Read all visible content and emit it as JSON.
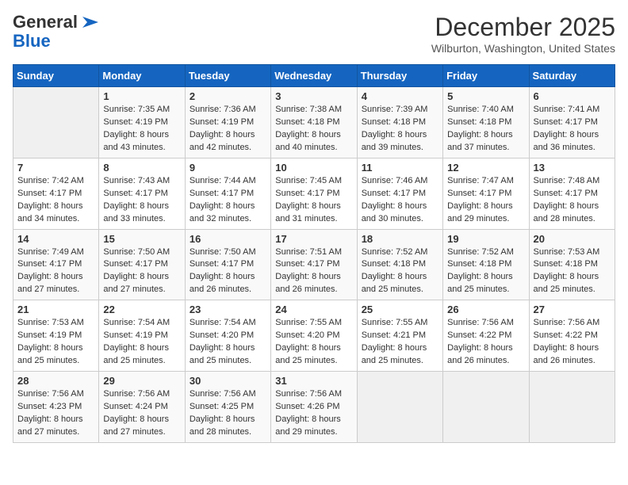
{
  "header": {
    "logo_line1": "General",
    "logo_line2": "Blue",
    "month": "December 2025",
    "location": "Wilburton, Washington, United States"
  },
  "days_of_week": [
    "Sunday",
    "Monday",
    "Tuesday",
    "Wednesday",
    "Thursday",
    "Friday",
    "Saturday"
  ],
  "weeks": [
    [
      {
        "day": "",
        "info": ""
      },
      {
        "day": "1",
        "info": "Sunrise: 7:35 AM\nSunset: 4:19 PM\nDaylight: 8 hours\nand 43 minutes."
      },
      {
        "day": "2",
        "info": "Sunrise: 7:36 AM\nSunset: 4:19 PM\nDaylight: 8 hours\nand 42 minutes."
      },
      {
        "day": "3",
        "info": "Sunrise: 7:38 AM\nSunset: 4:18 PM\nDaylight: 8 hours\nand 40 minutes."
      },
      {
        "day": "4",
        "info": "Sunrise: 7:39 AM\nSunset: 4:18 PM\nDaylight: 8 hours\nand 39 minutes."
      },
      {
        "day": "5",
        "info": "Sunrise: 7:40 AM\nSunset: 4:18 PM\nDaylight: 8 hours\nand 37 minutes."
      },
      {
        "day": "6",
        "info": "Sunrise: 7:41 AM\nSunset: 4:17 PM\nDaylight: 8 hours\nand 36 minutes."
      }
    ],
    [
      {
        "day": "7",
        "info": "Sunrise: 7:42 AM\nSunset: 4:17 PM\nDaylight: 8 hours\nand 34 minutes."
      },
      {
        "day": "8",
        "info": "Sunrise: 7:43 AM\nSunset: 4:17 PM\nDaylight: 8 hours\nand 33 minutes."
      },
      {
        "day": "9",
        "info": "Sunrise: 7:44 AM\nSunset: 4:17 PM\nDaylight: 8 hours\nand 32 minutes."
      },
      {
        "day": "10",
        "info": "Sunrise: 7:45 AM\nSunset: 4:17 PM\nDaylight: 8 hours\nand 31 minutes."
      },
      {
        "day": "11",
        "info": "Sunrise: 7:46 AM\nSunset: 4:17 PM\nDaylight: 8 hours\nand 30 minutes."
      },
      {
        "day": "12",
        "info": "Sunrise: 7:47 AM\nSunset: 4:17 PM\nDaylight: 8 hours\nand 29 minutes."
      },
      {
        "day": "13",
        "info": "Sunrise: 7:48 AM\nSunset: 4:17 PM\nDaylight: 8 hours\nand 28 minutes."
      }
    ],
    [
      {
        "day": "14",
        "info": "Sunrise: 7:49 AM\nSunset: 4:17 PM\nDaylight: 8 hours\nand 27 minutes."
      },
      {
        "day": "15",
        "info": "Sunrise: 7:50 AM\nSunset: 4:17 PM\nDaylight: 8 hours\nand 27 minutes."
      },
      {
        "day": "16",
        "info": "Sunrise: 7:50 AM\nSunset: 4:17 PM\nDaylight: 8 hours\nand 26 minutes."
      },
      {
        "day": "17",
        "info": "Sunrise: 7:51 AM\nSunset: 4:17 PM\nDaylight: 8 hours\nand 26 minutes."
      },
      {
        "day": "18",
        "info": "Sunrise: 7:52 AM\nSunset: 4:18 PM\nDaylight: 8 hours\nand 25 minutes."
      },
      {
        "day": "19",
        "info": "Sunrise: 7:52 AM\nSunset: 4:18 PM\nDaylight: 8 hours\nand 25 minutes."
      },
      {
        "day": "20",
        "info": "Sunrise: 7:53 AM\nSunset: 4:18 PM\nDaylight: 8 hours\nand 25 minutes."
      }
    ],
    [
      {
        "day": "21",
        "info": "Sunrise: 7:53 AM\nSunset: 4:19 PM\nDaylight: 8 hours\nand 25 minutes."
      },
      {
        "day": "22",
        "info": "Sunrise: 7:54 AM\nSunset: 4:19 PM\nDaylight: 8 hours\nand 25 minutes."
      },
      {
        "day": "23",
        "info": "Sunrise: 7:54 AM\nSunset: 4:20 PM\nDaylight: 8 hours\nand 25 minutes."
      },
      {
        "day": "24",
        "info": "Sunrise: 7:55 AM\nSunset: 4:20 PM\nDaylight: 8 hours\nand 25 minutes."
      },
      {
        "day": "25",
        "info": "Sunrise: 7:55 AM\nSunset: 4:21 PM\nDaylight: 8 hours\nand 25 minutes."
      },
      {
        "day": "26",
        "info": "Sunrise: 7:56 AM\nSunset: 4:22 PM\nDaylight: 8 hours\nand 26 minutes."
      },
      {
        "day": "27",
        "info": "Sunrise: 7:56 AM\nSunset: 4:22 PM\nDaylight: 8 hours\nand 26 minutes."
      }
    ],
    [
      {
        "day": "28",
        "info": "Sunrise: 7:56 AM\nSunset: 4:23 PM\nDaylight: 8 hours\nand 27 minutes."
      },
      {
        "day": "29",
        "info": "Sunrise: 7:56 AM\nSunset: 4:24 PM\nDaylight: 8 hours\nand 27 minutes."
      },
      {
        "day": "30",
        "info": "Sunrise: 7:56 AM\nSunset: 4:25 PM\nDaylight: 8 hours\nand 28 minutes."
      },
      {
        "day": "31",
        "info": "Sunrise: 7:56 AM\nSunset: 4:26 PM\nDaylight: 8 hours\nand 29 minutes."
      },
      {
        "day": "",
        "info": ""
      },
      {
        "day": "",
        "info": ""
      },
      {
        "day": "",
        "info": ""
      }
    ]
  ]
}
